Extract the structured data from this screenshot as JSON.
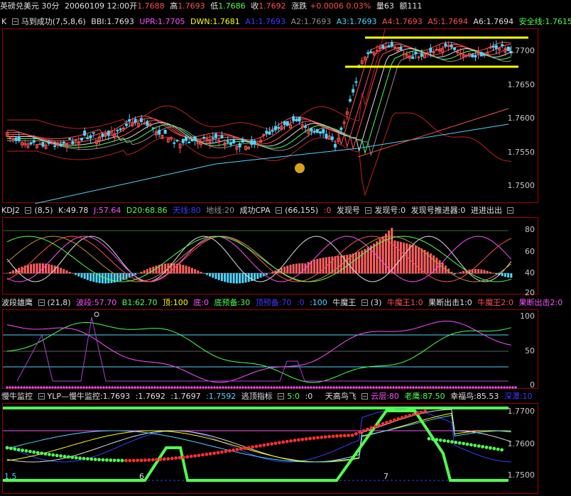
{
  "header": {
    "symbol": "英磅兑美元 30分",
    "date": "20060109 12:00",
    "open_label": "开",
    "open": "1.7688",
    "high_label": "高",
    "high": "1.7693",
    "low_label": "低",
    "low": "1.7686",
    "close_label": "收",
    "close": "1.7692",
    "change_label": "涨跌",
    "change": "+0.0006 0.03%",
    "vol_label": "量",
    "vol": "63",
    "amount_label": "额",
    "amount": "111"
  },
  "panel1": {
    "k": "K",
    "name": "马到成功",
    "params": "(7,5,8,6)",
    "bbi": "BBI:1.7693",
    "upr": "UPR:1.7705",
    "dwn": "DWN:1.7681",
    "a1": "A1:1.7693",
    "a2": "A2:1.7693",
    "a3": "A3:1.7693",
    "a4": "A4:1.7693",
    "a5": "A5:1.7694",
    "a6": "A6:1.7694",
    "safe": "安全线:1.7615",
    "ticks": [
      "1.7700",
      "1.7650",
      "1.7600",
      "1.7550",
      "1.7500"
    ]
  },
  "panel2": {
    "name": "KDJ2",
    "params": "(8,5)",
    "k": "K:49.78",
    "j": "J:57.64",
    "d20": "D20:68.86",
    "tian": "天线:80",
    "di": "地线:20",
    "cpa": "成功CPA",
    "cpa_params": "(66,155)",
    "zero": ":0",
    "fxh": "发现号",
    "fxh2": "发现号:0",
    "fxh3": "发现号推进器:0",
    "jinjin": "进进出出",
    "ticks": [
      "80",
      "60",
      "40",
      "20"
    ]
  },
  "panel3": {
    "name": "波段雄鹰",
    "params": "(21,8)",
    "bd": "波段:57.70",
    "b1": "B1:62.70",
    "top": "顶:100",
    "bottom": "底:0",
    "dyb": "底预备:30",
    "dingyb": "顶预备:70",
    "z0": ":0",
    "z100": ":100",
    "nmw": "牛魔王",
    "nmw_params": "(3)",
    "nmw1": "牛魔王1:0",
    "gdcj1": "果断出击1:0",
    "nmw2": "牛魔王2:0",
    "gdcj2": "果断出击2:0",
    "ticks": [
      "100",
      "50",
      "0"
    ]
  },
  "panel4": {
    "name": "慢牛监控",
    "ylp": "YLP—慢牛监控:1.7693",
    "v2": ":1.7692",
    "v3": ":1.7697",
    "v4": ":1.7592",
    "ttzb": "逃顶指标",
    "ttzb_v": "5:0",
    "z": ":0",
    "tgnf": "天高鸟飞",
    "yc": "云层:80",
    "ly": "老鹰:87.50",
    "xfn": "幸福鸟:85.53",
    "sc": "深潭:10",
    "ticks": [
      "1.7700",
      "1.7600",
      "1.7500"
    ],
    "bottom_marks": [
      "1.5",
      "6",
      "7"
    ]
  },
  "colors": {
    "red": "#ff5050",
    "cyan": "#4fd4ff",
    "yellow": "#ffff00",
    "green": "#50ff50",
    "magenta": "#ff50ff",
    "blue": "#3c3cff",
    "white": "#e0e0e0",
    "gray": "#909090"
  }
}
